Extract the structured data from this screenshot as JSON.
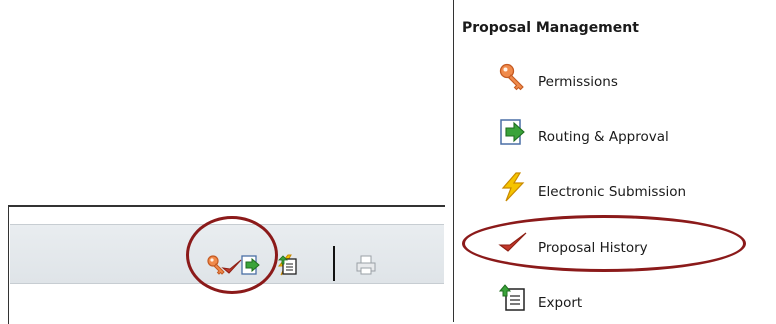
{
  "toolbar": {
    "buttons": [
      {
        "name": "permissions",
        "icon": "key-icon"
      },
      {
        "name": "routing-approval",
        "icon": "routing-arrow-icon"
      },
      {
        "name": "electronic-submission",
        "icon": "lightning-icon"
      },
      {
        "name": "proposal-history",
        "icon": "checkmark-icon",
        "highlighted": true
      },
      {
        "name": "export",
        "icon": "export-icon"
      },
      {
        "name": "print",
        "icon": "printer-icon",
        "disabled": true
      }
    ]
  },
  "menu": {
    "title": "Proposal Management",
    "items": [
      {
        "label": "Permissions",
        "icon": "key-icon"
      },
      {
        "label": "Routing & Approval",
        "icon": "routing-arrow-icon"
      },
      {
        "label": "Electronic Submission",
        "icon": "lightning-icon"
      },
      {
        "label": "Proposal History",
        "icon": "checkmark-icon",
        "highlighted": true
      },
      {
        "label": "Export",
        "icon": "export-icon"
      }
    ]
  },
  "colors": {
    "highlight_ring": "#8b1a1a",
    "key": "#e8804a",
    "routing_green": "#3aa33a",
    "lightning": "#f5c400",
    "checkmark": "#c0392b",
    "toolbar_bg": "#e4e8eb"
  }
}
